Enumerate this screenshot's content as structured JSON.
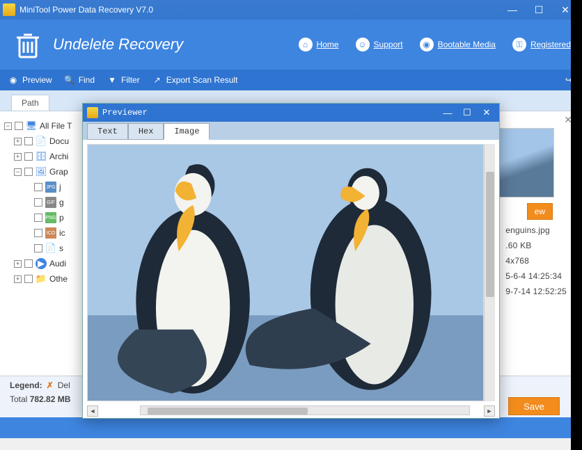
{
  "titlebar": {
    "title": "MiniTool Power Data Recovery V7.0"
  },
  "header": {
    "title": "Undelete Recovery",
    "links": {
      "home": "Home",
      "support": "Support",
      "bootable": "Bootable Media",
      "registered": "Registered"
    }
  },
  "toolbar": {
    "preview": "Preview",
    "find": "Find",
    "filter": "Filter",
    "export": "Export Scan Result"
  },
  "tabs": {
    "path": "Path"
  },
  "tree": {
    "root": "All File T",
    "docu": "Docu",
    "archi": "Archi",
    "grap": "Grap",
    "jpeg": "j",
    "gif": "g",
    "png": "p",
    "ico": "ic",
    "sys": "s",
    "audio": "Audi",
    "other": "Othe"
  },
  "detail": {
    "preview_btn": "ew",
    "filename": "enguins.jpg",
    "size": ".60 KB",
    "dimensions": "4x768",
    "created": "5-6-4 14:25:34",
    "modified": "9-7-14 12:52:25"
  },
  "bottom": {
    "legend_label": "Legend:",
    "legend_del": "Del",
    "total_label": "Total ",
    "total_value": "782.82 MB",
    "save": "Save"
  },
  "previewer": {
    "title": "Previewer",
    "tabs": {
      "text": "Text",
      "hex": "Hex",
      "image": "Image"
    }
  }
}
